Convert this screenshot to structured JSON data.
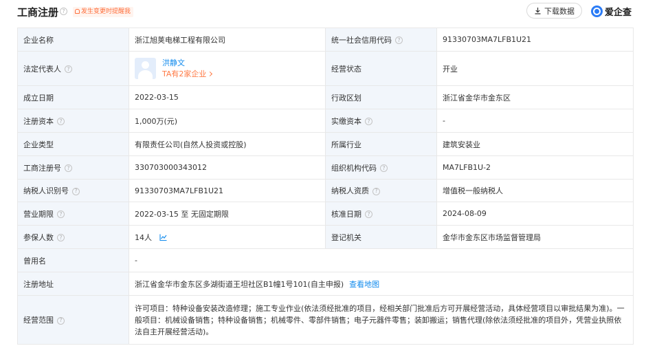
{
  "header": {
    "title": "工商注册",
    "reminder": "发生变更时提醒我",
    "download_label": "下载数据",
    "brand_name": "爱企查"
  },
  "info": {
    "company_name_label": "企业名称",
    "company_name": "浙江旭荚电梯工程有限公司",
    "credit_code_label": "统一社会信用代码",
    "credit_code": "91330703MA7LFB1U21",
    "legal_rep_label": "法定代表人",
    "legal_rep_name": "洪静文",
    "legal_rep_companies": "TA有2家企业",
    "status_label": "经营状态",
    "status": "开业",
    "founded_label": "成立日期",
    "founded": "2022-03-15",
    "region_label": "行政区划",
    "region": "浙江省金华市金东区",
    "reg_capital_label": "注册资本",
    "reg_capital": "1,000万(元)",
    "paid_capital_label": "实缴资本",
    "paid_capital": "-",
    "type_label": "企业类型",
    "type": "有限责任公司(自然人投资或控股)",
    "industry_label": "所属行业",
    "industry": "建筑安装业",
    "reg_no_label": "工商注册号",
    "reg_no": "330703000343012",
    "org_code_label": "组织机构代码",
    "org_code": "MA7LFB1U-2",
    "taxpayer_id_label": "纳税人识别号",
    "taxpayer_id": "91330703MA7LFB1U21",
    "taxpayer_qual_label": "纳税人资质",
    "taxpayer_qual": "增值税一般纳税人",
    "term_label": "营业期限",
    "term": "2022-03-15 至 无固定期限",
    "approval_label": "核准日期",
    "approval": "2024-08-09",
    "insured_label": "参保人数",
    "insured": "14人",
    "authority_label": "登记机关",
    "authority": "金华市金东区市场监督管理局",
    "former_name_label": "曾用名",
    "former_name": "-",
    "address_label": "注册地址",
    "address": "浙江省金华市金东区多湖街道王坦社区B1幢1号101(自主申报)",
    "map_link": "查看地图",
    "scope_label": "经营范围",
    "scope": "许可项目：特种设备安装改造修理；施工专业作业(依法须经批准的项目，经相关部门批准后方可开展经营活动，具体经营项目以审批结果为准)。一般项目：机械设备销售；特种设备销售；机械零件、零部件销售；电子元器件零售；装卸搬运；销售代理(除依法须经批准的项目外，凭营业执照依法自主开展经营活动)。"
  },
  "colors": {
    "label_bg": "#f2f6fb",
    "border": "#e8e8e8",
    "link": "#128bed",
    "accent_orange": "#ff7a45"
  },
  "icons": [
    "help-icon",
    "bell-icon",
    "download-icon",
    "brand-logo-icon",
    "avatar-icon",
    "chevron-right-icon",
    "trend-chart-icon"
  ]
}
